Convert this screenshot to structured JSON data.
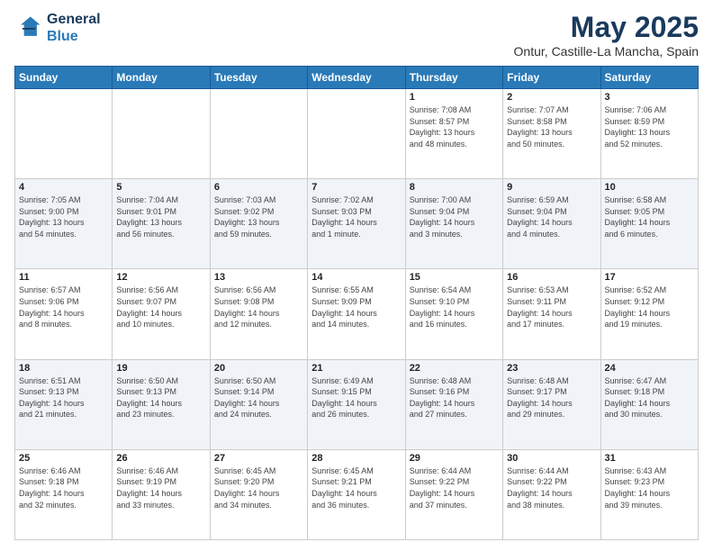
{
  "logo": {
    "line1": "General",
    "line2": "Blue"
  },
  "title": "May 2025",
  "subtitle": "Ontur, Castille-La Mancha, Spain",
  "weekdays": [
    "Sunday",
    "Monday",
    "Tuesday",
    "Wednesday",
    "Thursday",
    "Friday",
    "Saturday"
  ],
  "weeks": [
    [
      {
        "day": "",
        "info": ""
      },
      {
        "day": "",
        "info": ""
      },
      {
        "day": "",
        "info": ""
      },
      {
        "day": "",
        "info": ""
      },
      {
        "day": "1",
        "info": "Sunrise: 7:08 AM\nSunset: 8:57 PM\nDaylight: 13 hours\nand 48 minutes."
      },
      {
        "day": "2",
        "info": "Sunrise: 7:07 AM\nSunset: 8:58 PM\nDaylight: 13 hours\nand 50 minutes."
      },
      {
        "day": "3",
        "info": "Sunrise: 7:06 AM\nSunset: 8:59 PM\nDaylight: 13 hours\nand 52 minutes."
      }
    ],
    [
      {
        "day": "4",
        "info": "Sunrise: 7:05 AM\nSunset: 9:00 PM\nDaylight: 13 hours\nand 54 minutes."
      },
      {
        "day": "5",
        "info": "Sunrise: 7:04 AM\nSunset: 9:01 PM\nDaylight: 13 hours\nand 56 minutes."
      },
      {
        "day": "6",
        "info": "Sunrise: 7:03 AM\nSunset: 9:02 PM\nDaylight: 13 hours\nand 59 minutes."
      },
      {
        "day": "7",
        "info": "Sunrise: 7:02 AM\nSunset: 9:03 PM\nDaylight: 14 hours\nand 1 minute."
      },
      {
        "day": "8",
        "info": "Sunrise: 7:00 AM\nSunset: 9:04 PM\nDaylight: 14 hours\nand 3 minutes."
      },
      {
        "day": "9",
        "info": "Sunrise: 6:59 AM\nSunset: 9:04 PM\nDaylight: 14 hours\nand 4 minutes."
      },
      {
        "day": "10",
        "info": "Sunrise: 6:58 AM\nSunset: 9:05 PM\nDaylight: 14 hours\nand 6 minutes."
      }
    ],
    [
      {
        "day": "11",
        "info": "Sunrise: 6:57 AM\nSunset: 9:06 PM\nDaylight: 14 hours\nand 8 minutes."
      },
      {
        "day": "12",
        "info": "Sunrise: 6:56 AM\nSunset: 9:07 PM\nDaylight: 14 hours\nand 10 minutes."
      },
      {
        "day": "13",
        "info": "Sunrise: 6:56 AM\nSunset: 9:08 PM\nDaylight: 14 hours\nand 12 minutes."
      },
      {
        "day": "14",
        "info": "Sunrise: 6:55 AM\nSunset: 9:09 PM\nDaylight: 14 hours\nand 14 minutes."
      },
      {
        "day": "15",
        "info": "Sunrise: 6:54 AM\nSunset: 9:10 PM\nDaylight: 14 hours\nand 16 minutes."
      },
      {
        "day": "16",
        "info": "Sunrise: 6:53 AM\nSunset: 9:11 PM\nDaylight: 14 hours\nand 17 minutes."
      },
      {
        "day": "17",
        "info": "Sunrise: 6:52 AM\nSunset: 9:12 PM\nDaylight: 14 hours\nand 19 minutes."
      }
    ],
    [
      {
        "day": "18",
        "info": "Sunrise: 6:51 AM\nSunset: 9:13 PM\nDaylight: 14 hours\nand 21 minutes."
      },
      {
        "day": "19",
        "info": "Sunrise: 6:50 AM\nSunset: 9:13 PM\nDaylight: 14 hours\nand 23 minutes."
      },
      {
        "day": "20",
        "info": "Sunrise: 6:50 AM\nSunset: 9:14 PM\nDaylight: 14 hours\nand 24 minutes."
      },
      {
        "day": "21",
        "info": "Sunrise: 6:49 AM\nSunset: 9:15 PM\nDaylight: 14 hours\nand 26 minutes."
      },
      {
        "day": "22",
        "info": "Sunrise: 6:48 AM\nSunset: 9:16 PM\nDaylight: 14 hours\nand 27 minutes."
      },
      {
        "day": "23",
        "info": "Sunrise: 6:48 AM\nSunset: 9:17 PM\nDaylight: 14 hours\nand 29 minutes."
      },
      {
        "day": "24",
        "info": "Sunrise: 6:47 AM\nSunset: 9:18 PM\nDaylight: 14 hours\nand 30 minutes."
      }
    ],
    [
      {
        "day": "25",
        "info": "Sunrise: 6:46 AM\nSunset: 9:18 PM\nDaylight: 14 hours\nand 32 minutes."
      },
      {
        "day": "26",
        "info": "Sunrise: 6:46 AM\nSunset: 9:19 PM\nDaylight: 14 hours\nand 33 minutes."
      },
      {
        "day": "27",
        "info": "Sunrise: 6:45 AM\nSunset: 9:20 PM\nDaylight: 14 hours\nand 34 minutes."
      },
      {
        "day": "28",
        "info": "Sunrise: 6:45 AM\nSunset: 9:21 PM\nDaylight: 14 hours\nand 36 minutes."
      },
      {
        "day": "29",
        "info": "Sunrise: 6:44 AM\nSunset: 9:22 PM\nDaylight: 14 hours\nand 37 minutes."
      },
      {
        "day": "30",
        "info": "Sunrise: 6:44 AM\nSunset: 9:22 PM\nDaylight: 14 hours\nand 38 minutes."
      },
      {
        "day": "31",
        "info": "Sunrise: 6:43 AM\nSunset: 9:23 PM\nDaylight: 14 hours\nand 39 minutes."
      }
    ]
  ]
}
